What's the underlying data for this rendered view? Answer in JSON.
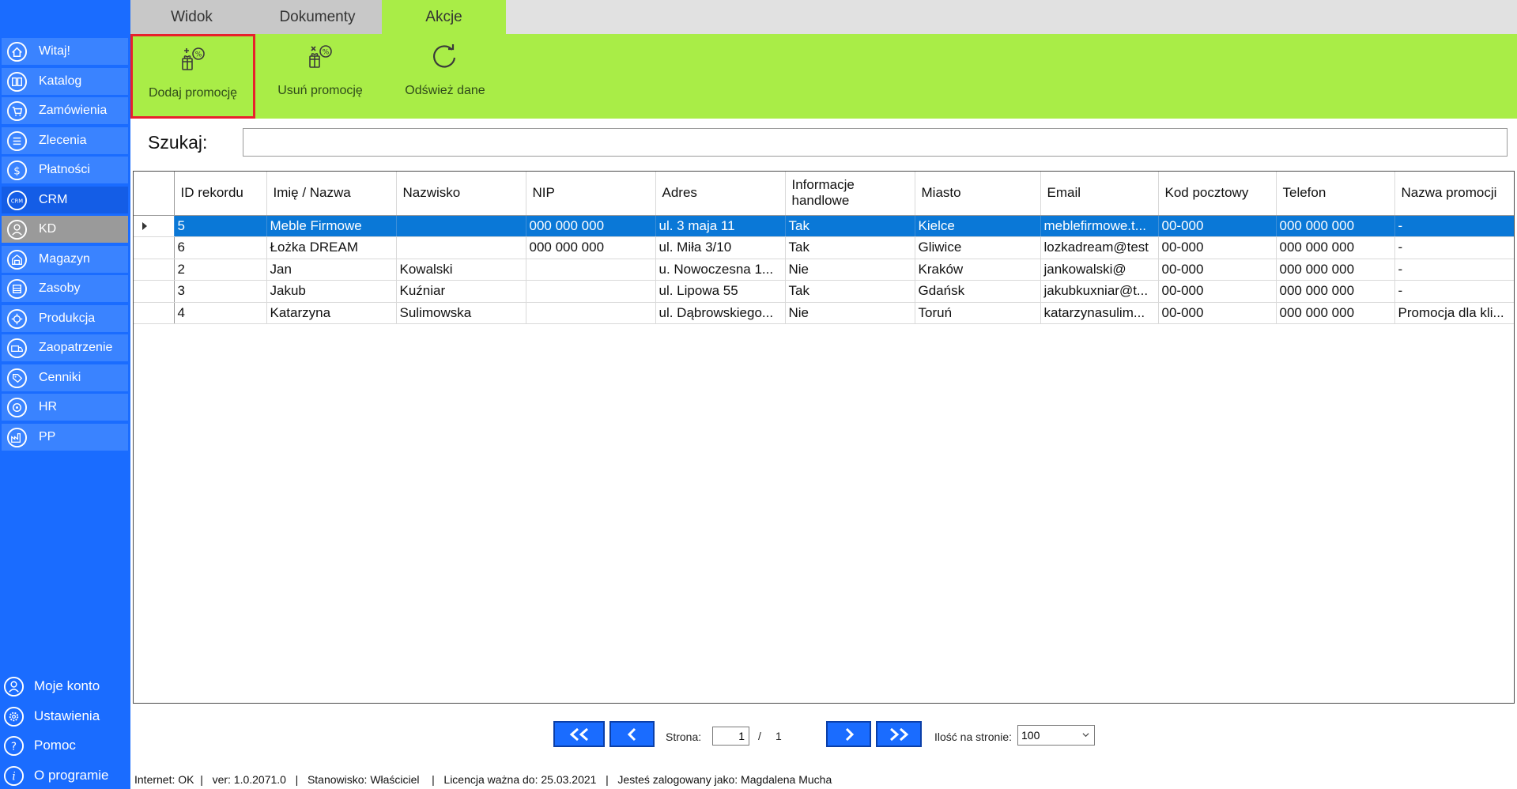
{
  "tabs": [
    {
      "label": "Widok"
    },
    {
      "label": "Dokumenty"
    },
    {
      "label": "Akcje"
    }
  ],
  "ribbon": {
    "buttons": [
      {
        "label": "Dodaj promocję",
        "icon": "add-promotion-icon"
      },
      {
        "label": "Usuń promocję",
        "icon": "remove-promotion-icon"
      },
      {
        "label": "Odśwież dane",
        "icon": "refresh-icon"
      }
    ]
  },
  "search": {
    "label": "Szukaj:",
    "value": ""
  },
  "sidebar": {
    "items": [
      {
        "label": "Witaj!",
        "icon": "home-icon"
      },
      {
        "label": "Katalog",
        "icon": "book-icon"
      },
      {
        "label": "Zamówienia",
        "icon": "cart-icon"
      },
      {
        "label": "Zlecenia",
        "icon": "list-icon"
      },
      {
        "label": "Płatności",
        "icon": "dollar-icon"
      },
      {
        "label": "CRM",
        "icon": "crm-icon"
      },
      {
        "label": "KD",
        "icon": "user-icon"
      },
      {
        "label": "Magazyn",
        "icon": "warehouse-icon"
      },
      {
        "label": "Zasoby",
        "icon": "resources-icon"
      },
      {
        "label": "Produkcja",
        "icon": "production-icon"
      },
      {
        "label": "Zaopatrzenie",
        "icon": "truck-icon"
      },
      {
        "label": "Cenniki",
        "icon": "tag-icon"
      },
      {
        "label": "HR",
        "icon": "hr-icon"
      },
      {
        "label": "PP",
        "icon": "factory-icon"
      }
    ],
    "bottom": [
      {
        "label": "Moje konto",
        "icon": "account-icon"
      },
      {
        "label": "Ustawienia",
        "icon": "gear-icon"
      },
      {
        "label": "Pomoc",
        "icon": "help-icon"
      },
      {
        "label": "O programie",
        "icon": "info-icon"
      }
    ]
  },
  "table": {
    "columns": [
      "ID rekordu",
      "Imię / Nazwa",
      "Nazwisko",
      "NIP",
      "Adres",
      "Informacje handlowe",
      "Miasto",
      "Email",
      "Kod pocztowy",
      "Telefon",
      "Nazwa promocji"
    ],
    "rows": [
      [
        "5",
        "Meble Firmowe",
        "",
        "000 000 000",
        "ul. 3 maja 11",
        "Tak",
        "Kielce",
        "meblefirmowe.t...",
        "00-000",
        "000 000 000",
        "-"
      ],
      [
        "6",
        "Łożka DREAM",
        "",
        "000 000 000",
        "ul. Miła 3/10",
        "Tak",
        "Gliwice",
        "lozkadream@test",
        "00-000",
        "000 000 000",
        "-"
      ],
      [
        "2",
        "Jan",
        "Kowalski",
        "",
        "u. Nowoczesna 1...",
        "Nie",
        "Kraków",
        "jankowalski@",
        "00-000",
        "000 000 000",
        "-"
      ],
      [
        "3",
        "Jakub",
        "Kuźniar",
        "",
        "ul. Lipowa 55",
        "Tak",
        "Gdańsk",
        "jakubkuxniar@t...",
        "00-000",
        "000 000 000",
        "-"
      ],
      [
        "4",
        "Katarzyna",
        "Sulimowska",
        "",
        "ul. Dąbrowskiego...",
        "Nie",
        "Toruń",
        "katarzynasulim...",
        "00-000",
        "000 000 000",
        "Promocja dla kli..."
      ]
    ],
    "selected_row": 0
  },
  "pager": {
    "page_label": "Strona:",
    "current_page": "1",
    "separator": "/",
    "total_pages": "1",
    "per_page_label": "Ilość na stronie:",
    "per_page_value": "100"
  },
  "status": {
    "text": "Internet: OK  |   ver: 1.0.2071.0   |   Stanowisko: Właściciel    |   Licencja ważna do: 25.03.2021   |   Jesteś zalogowany jako: Magdalena Mucha"
  },
  "colors": {
    "sidebar": "#1a6cff",
    "ribbon": "#a9ed47",
    "selection": "#0a78d7",
    "highlight_border": "#e8202c"
  }
}
